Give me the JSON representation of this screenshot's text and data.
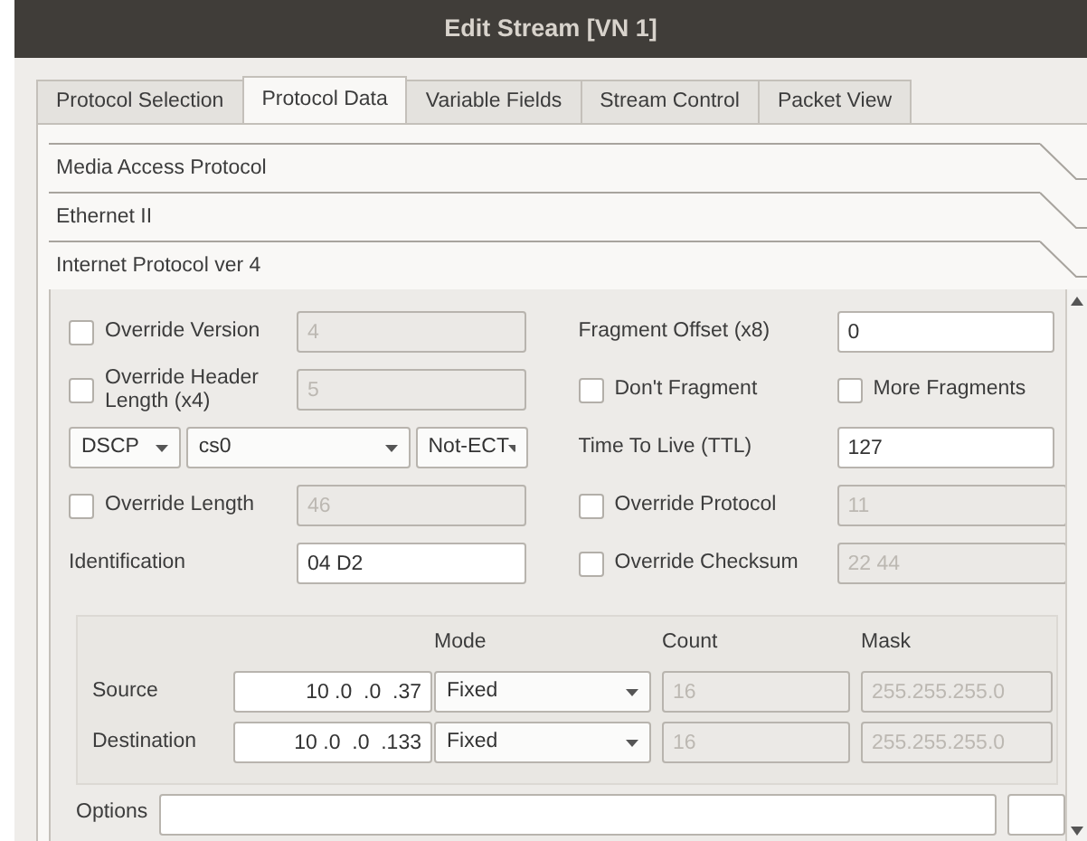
{
  "window": {
    "title": "Edit Stream [VN 1]"
  },
  "tabs": [
    {
      "label": "Protocol Selection",
      "selected": false
    },
    {
      "label": "Protocol Data",
      "selected": true
    },
    {
      "label": "Variable Fields",
      "selected": false
    },
    {
      "label": "Stream Control",
      "selected": false
    },
    {
      "label": "Packet View",
      "selected": false
    }
  ],
  "sections": [
    {
      "title": "Media Access Protocol"
    },
    {
      "title": "Ethernet II"
    },
    {
      "title": "Internet Protocol ver 4"
    }
  ],
  "ipv4": {
    "left": [
      {
        "kind": "check-field",
        "label": "Override Version",
        "checked": false,
        "value": "4",
        "disabled": true
      },
      {
        "kind": "check-field",
        "label": "Override Header Length (x4)",
        "checked": false,
        "value": "5",
        "disabled": true
      },
      {
        "kind": "selects",
        "options": [
          "DSCP",
          "cs0",
          "Not-ECT"
        ]
      },
      {
        "kind": "check-field",
        "label": "Override Length",
        "checked": false,
        "value": "46",
        "disabled": true
      },
      {
        "kind": "label-field",
        "label": "Identification",
        "value": "04 D2",
        "disabled": false
      }
    ],
    "right": [
      {
        "kind": "label-field",
        "label": "Fragment Offset (x8)",
        "value": "0",
        "disabled": false
      },
      {
        "kind": "check-pair",
        "items": [
          {
            "label": "Don't Fragment",
            "checked": false
          },
          {
            "label": "More Fragments",
            "checked": false
          }
        ]
      },
      {
        "kind": "label-field",
        "label": "Time To Live (TTL)",
        "value": "127",
        "disabled": false
      },
      {
        "kind": "check-field",
        "label": "Override Protocol",
        "checked": false,
        "value": "11",
        "disabled": true
      },
      {
        "kind": "check-field",
        "label": "Override Checksum",
        "checked": false,
        "value": "22 44",
        "disabled": true
      }
    ],
    "addresses": {
      "columns": [
        "Mode",
        "Count",
        "Mask"
      ],
      "rows": [
        {
          "label": "Source",
          "address": "10 .0  .0  .37",
          "mode": "Fixed",
          "count": "16",
          "mask": "255.255.255.0"
        },
        {
          "label": "Destination",
          "address": "10 .0  .0  .133",
          "mode": "Fixed",
          "count": "16",
          "mask": "255.255.255.0"
        }
      ]
    },
    "options": {
      "label": "Options"
    }
  }
}
